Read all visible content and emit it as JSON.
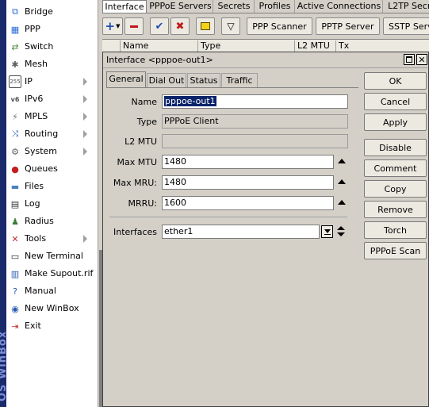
{
  "brand_vertical": "OS WinBox",
  "sidebar": {
    "items": [
      {
        "label": "Bridge",
        "icon": "bridge-icon",
        "glyph": "⧉",
        "color": "#2a6bd6",
        "submenu": false
      },
      {
        "label": "PPP",
        "icon": "ppp-icon",
        "glyph": "▦",
        "color": "#2a6bd6",
        "submenu": false
      },
      {
        "label": "Switch",
        "icon": "switch-icon",
        "glyph": "⇄",
        "color": "#4a8a3a",
        "submenu": false
      },
      {
        "label": "Mesh",
        "icon": "mesh-icon",
        "glyph": "✱",
        "color": "#606060",
        "submenu": false
      },
      {
        "label": "IP",
        "icon": "ip-icon",
        "glyph": "255",
        "color": "#505050",
        "submenu": true
      },
      {
        "label": "IPv6",
        "icon": "ipv6-icon",
        "glyph": "v6",
        "color": "#505050",
        "submenu": true
      },
      {
        "label": "MPLS",
        "icon": "mpls-icon",
        "glyph": "⚡",
        "color": "#707070",
        "submenu": true
      },
      {
        "label": "Routing",
        "icon": "routing-icon",
        "glyph": "⤨",
        "color": "#3a6ac0",
        "submenu": true
      },
      {
        "label": "System",
        "icon": "system-icon",
        "glyph": "⚙",
        "color": "#606060",
        "submenu": true
      },
      {
        "label": "Queues",
        "icon": "queues-icon",
        "glyph": "●",
        "color": "#c02020",
        "submenu": false
      },
      {
        "label": "Files",
        "icon": "files-icon",
        "glyph": "▬",
        "color": "#4a7fc0",
        "submenu": false
      },
      {
        "label": "Log",
        "icon": "log-icon",
        "glyph": "▤",
        "color": "#303030",
        "submenu": false
      },
      {
        "label": "Radius",
        "icon": "radius-icon",
        "glyph": "♟",
        "color": "#3a7a3a",
        "submenu": false
      },
      {
        "label": "Tools",
        "icon": "tools-icon",
        "glyph": "✕",
        "color": "#c03030",
        "submenu": true
      },
      {
        "label": "New Terminal",
        "icon": "terminal-icon",
        "glyph": "▭",
        "color": "#202020",
        "submenu": false
      },
      {
        "label": "Make Supout.rif",
        "icon": "supout-icon",
        "glyph": "▥",
        "color": "#2a5ab0",
        "submenu": false
      },
      {
        "label": "Manual",
        "icon": "manual-icon",
        "glyph": "?",
        "color": "#2a5ab0",
        "submenu": false
      },
      {
        "label": "New WinBox",
        "icon": "winbox-icon",
        "glyph": "◉",
        "color": "#2a5ab0",
        "submenu": false
      },
      {
        "label": "Exit",
        "icon": "exit-icon",
        "glyph": "⇥",
        "color": "#c03030",
        "submenu": false
      }
    ]
  },
  "main": {
    "tabs": [
      "Interface",
      "PPPoE Servers",
      "Secrets",
      "Profiles",
      "Active Connections",
      "L2TP Secre"
    ],
    "active_tab": 0,
    "toolbar": {
      "pppoe_scanner": "PPP Scanner",
      "pptp_server": "PPTP Server",
      "sstp_server": "SSTP Serv"
    },
    "list_columns": [
      "Name",
      "Type",
      "L2 MTU",
      "Tx"
    ]
  },
  "dialog": {
    "title": "Interface <pppoe-out1>",
    "tabs": [
      "General",
      "Dial Out",
      "Status",
      "Traffic"
    ],
    "active_tab": 0,
    "fields": {
      "name_label": "Name",
      "name_value": "pppoe-out1",
      "type_label": "Type",
      "type_value": "PPPoE Client",
      "l2mtu_label": "L2 MTU",
      "l2mtu_value": "",
      "maxmtu_label": "Max MTU",
      "maxmtu_value": "1480",
      "maxmru_label": "Max MRU:",
      "maxmru_value": "1480",
      "mrru_label": "MRRU:",
      "mrru_value": "1600",
      "interfaces_label": "Interfaces",
      "interfaces_value": "ether1"
    },
    "buttons": [
      "OK",
      "Cancel",
      "Apply",
      "Disable",
      "Comment",
      "Copy",
      "Remove",
      "Torch",
      "PPPoE Scan"
    ]
  }
}
